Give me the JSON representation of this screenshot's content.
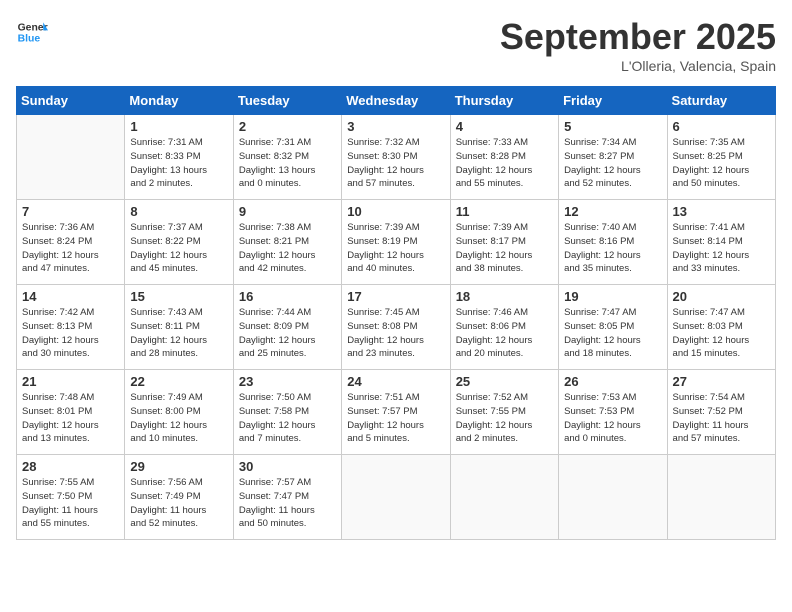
{
  "header": {
    "logo_line1": "General",
    "logo_line2": "Blue",
    "month": "September 2025",
    "location": "L'Olleria, Valencia, Spain"
  },
  "weekdays": [
    "Sunday",
    "Monday",
    "Tuesday",
    "Wednesday",
    "Thursday",
    "Friday",
    "Saturday"
  ],
  "weeks": [
    [
      {
        "day": "",
        "info": ""
      },
      {
        "day": "1",
        "info": "Sunrise: 7:31 AM\nSunset: 8:33 PM\nDaylight: 13 hours\nand 2 minutes."
      },
      {
        "day": "2",
        "info": "Sunrise: 7:31 AM\nSunset: 8:32 PM\nDaylight: 13 hours\nand 0 minutes."
      },
      {
        "day": "3",
        "info": "Sunrise: 7:32 AM\nSunset: 8:30 PM\nDaylight: 12 hours\nand 57 minutes."
      },
      {
        "day": "4",
        "info": "Sunrise: 7:33 AM\nSunset: 8:28 PM\nDaylight: 12 hours\nand 55 minutes."
      },
      {
        "day": "5",
        "info": "Sunrise: 7:34 AM\nSunset: 8:27 PM\nDaylight: 12 hours\nand 52 minutes."
      },
      {
        "day": "6",
        "info": "Sunrise: 7:35 AM\nSunset: 8:25 PM\nDaylight: 12 hours\nand 50 minutes."
      }
    ],
    [
      {
        "day": "7",
        "info": "Sunrise: 7:36 AM\nSunset: 8:24 PM\nDaylight: 12 hours\nand 47 minutes."
      },
      {
        "day": "8",
        "info": "Sunrise: 7:37 AM\nSunset: 8:22 PM\nDaylight: 12 hours\nand 45 minutes."
      },
      {
        "day": "9",
        "info": "Sunrise: 7:38 AM\nSunset: 8:21 PM\nDaylight: 12 hours\nand 42 minutes."
      },
      {
        "day": "10",
        "info": "Sunrise: 7:39 AM\nSunset: 8:19 PM\nDaylight: 12 hours\nand 40 minutes."
      },
      {
        "day": "11",
        "info": "Sunrise: 7:39 AM\nSunset: 8:17 PM\nDaylight: 12 hours\nand 38 minutes."
      },
      {
        "day": "12",
        "info": "Sunrise: 7:40 AM\nSunset: 8:16 PM\nDaylight: 12 hours\nand 35 minutes."
      },
      {
        "day": "13",
        "info": "Sunrise: 7:41 AM\nSunset: 8:14 PM\nDaylight: 12 hours\nand 33 minutes."
      }
    ],
    [
      {
        "day": "14",
        "info": "Sunrise: 7:42 AM\nSunset: 8:13 PM\nDaylight: 12 hours\nand 30 minutes."
      },
      {
        "day": "15",
        "info": "Sunrise: 7:43 AM\nSunset: 8:11 PM\nDaylight: 12 hours\nand 28 minutes."
      },
      {
        "day": "16",
        "info": "Sunrise: 7:44 AM\nSunset: 8:09 PM\nDaylight: 12 hours\nand 25 minutes."
      },
      {
        "day": "17",
        "info": "Sunrise: 7:45 AM\nSunset: 8:08 PM\nDaylight: 12 hours\nand 23 minutes."
      },
      {
        "day": "18",
        "info": "Sunrise: 7:46 AM\nSunset: 8:06 PM\nDaylight: 12 hours\nand 20 minutes."
      },
      {
        "day": "19",
        "info": "Sunrise: 7:47 AM\nSunset: 8:05 PM\nDaylight: 12 hours\nand 18 minutes."
      },
      {
        "day": "20",
        "info": "Sunrise: 7:47 AM\nSunset: 8:03 PM\nDaylight: 12 hours\nand 15 minutes."
      }
    ],
    [
      {
        "day": "21",
        "info": "Sunrise: 7:48 AM\nSunset: 8:01 PM\nDaylight: 12 hours\nand 13 minutes."
      },
      {
        "day": "22",
        "info": "Sunrise: 7:49 AM\nSunset: 8:00 PM\nDaylight: 12 hours\nand 10 minutes."
      },
      {
        "day": "23",
        "info": "Sunrise: 7:50 AM\nSunset: 7:58 PM\nDaylight: 12 hours\nand 7 minutes."
      },
      {
        "day": "24",
        "info": "Sunrise: 7:51 AM\nSunset: 7:57 PM\nDaylight: 12 hours\nand 5 minutes."
      },
      {
        "day": "25",
        "info": "Sunrise: 7:52 AM\nSunset: 7:55 PM\nDaylight: 12 hours\nand 2 minutes."
      },
      {
        "day": "26",
        "info": "Sunrise: 7:53 AM\nSunset: 7:53 PM\nDaylight: 12 hours\nand 0 minutes."
      },
      {
        "day": "27",
        "info": "Sunrise: 7:54 AM\nSunset: 7:52 PM\nDaylight: 11 hours\nand 57 minutes."
      }
    ],
    [
      {
        "day": "28",
        "info": "Sunrise: 7:55 AM\nSunset: 7:50 PM\nDaylight: 11 hours\nand 55 minutes."
      },
      {
        "day": "29",
        "info": "Sunrise: 7:56 AM\nSunset: 7:49 PM\nDaylight: 11 hours\nand 52 minutes."
      },
      {
        "day": "30",
        "info": "Sunrise: 7:57 AM\nSunset: 7:47 PM\nDaylight: 11 hours\nand 50 minutes."
      },
      {
        "day": "",
        "info": ""
      },
      {
        "day": "",
        "info": ""
      },
      {
        "day": "",
        "info": ""
      },
      {
        "day": "",
        "info": ""
      }
    ]
  ]
}
